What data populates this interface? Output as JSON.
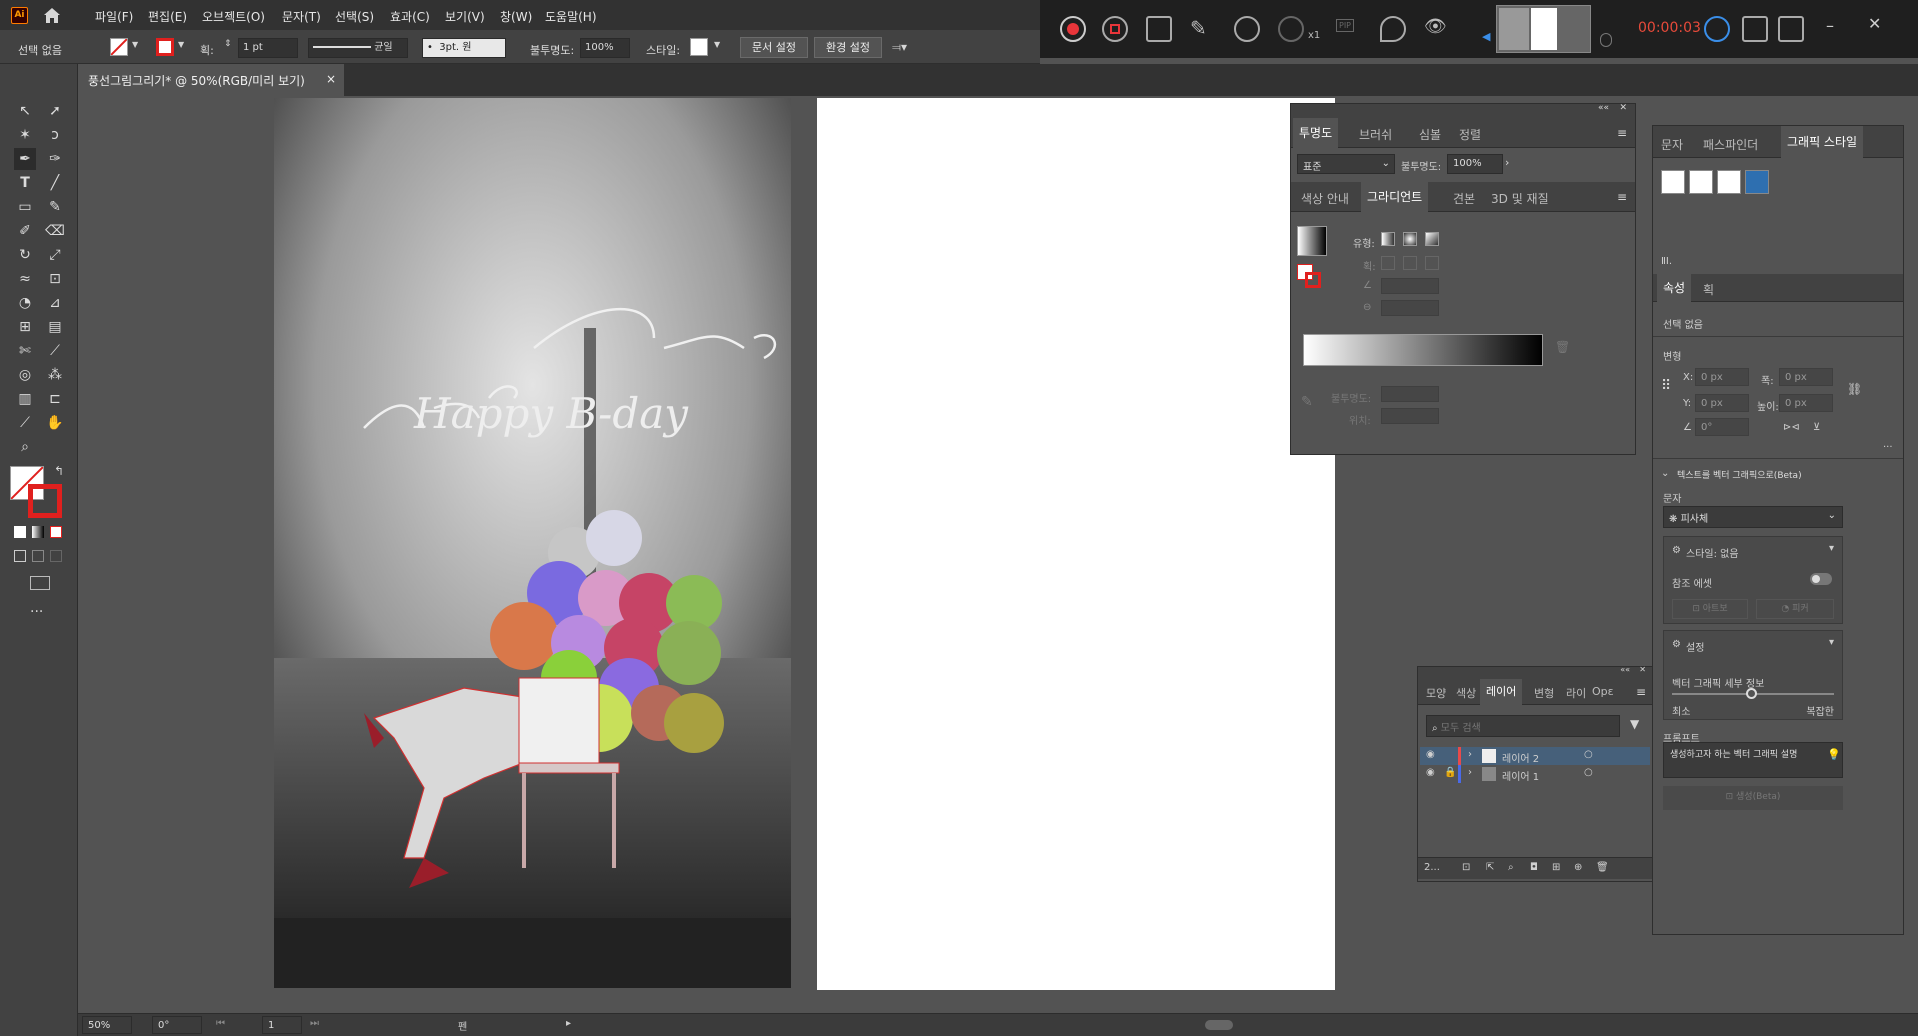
{
  "app": {
    "logo": "Ai",
    "home_icon": "home-icon"
  },
  "menu": [
    "파일(F)",
    "편집(E)",
    "오브젝트(O)",
    "문자(T)",
    "선택(S)",
    "효과(C)",
    "보기(V)",
    "창(W)",
    "도움말(H)"
  ],
  "recorder": {
    "timer": "00:00:03",
    "zoom_label": "x1",
    "pip_label": "PIP"
  },
  "options": {
    "selection": "선택 없음",
    "stroke_label": "획:",
    "stroke_value": "1 pt",
    "stroke_style": "균일",
    "brush": "3pt. 원",
    "opacity_label": "불투명도:",
    "opacity_value": "100%",
    "style_label": "스타일:",
    "doc_setup": "문서 설정",
    "prefs": "환경 설정"
  },
  "doc_tab": {
    "title": "풍선그림그리기* @ 50%(RGB/미리 보기)",
    "close": "×"
  },
  "transparency_panel": {
    "tabs": [
      "투명도",
      "브러쉬",
      "심볼",
      "정렬"
    ],
    "blend_mode": "표준",
    "opacity_label": "불투명도:",
    "opacity_value": "100%"
  },
  "gradient_panel": {
    "tabs": [
      "색상 안내",
      "그라디언트",
      "견본",
      "3D 및 재질"
    ],
    "type_label": "유형:",
    "stroke_label": "획:",
    "opacity_label": "불투명도:",
    "position_label": "위치:"
  },
  "right_panel": {
    "tabs": [
      "문자",
      "패스파인더",
      "그래픽 스타일"
    ],
    "sub_tabs": [
      "속성",
      "획"
    ],
    "no_selection": "선택 없음",
    "transform": "변형",
    "x_label": "X:",
    "y_label": "Y:",
    "x_value": "0 px",
    "y_value": "0 px",
    "w_label": "폭:",
    "h_label": "높이:",
    "w_value": "0 px",
    "h_value": "0 px",
    "angle_value": "0°",
    "text_to_vector": "텍스트를 벡터 그래픽으로(Beta)",
    "type_label": "문자",
    "subject_value": "피사체",
    "style_value": "스타일: 없음",
    "reference_asset": "참조 에셋",
    "artboard_btn": "아트보",
    "picker_btn": "피커",
    "settings": "설정",
    "vector_detail": "벡터 그래픽 세부 정보",
    "min": "최소",
    "complex": "복잡한",
    "prompt_label": "프롬프트",
    "prompt_placeholder": "생성하고자 하는 벡터 그래픽 설명",
    "generate_btn": "생성(Beta)"
  },
  "layers_panel": {
    "tabs": [
      "모양",
      "색상",
      "레이어",
      "변형",
      "라이",
      "Opε"
    ],
    "search_placeholder": "모두 검색",
    "layers": [
      {
        "name": "레이어 2",
        "color": "#e84a4a"
      },
      {
        "name": "레이어 1",
        "color": "#4a6ae8"
      }
    ],
    "count": "2..."
  },
  "artwork": {
    "text": "Happy B-day"
  },
  "status": {
    "zoom": "50%",
    "rotate": "0°",
    "page": "1",
    "tool": "펜"
  }
}
